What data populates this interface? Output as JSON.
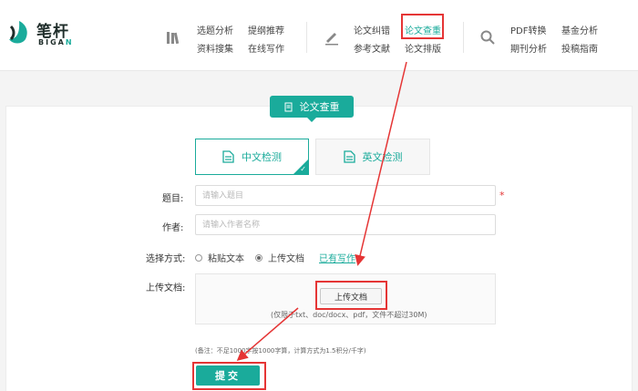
{
  "logo": {
    "cn": "笔杆",
    "en_main": "BIGA",
    "en_accent": "N"
  },
  "nav": {
    "group1": {
      "row1": [
        "选题分析",
        "提纲推荐"
      ],
      "row2": [
        "资料搜集",
        "在线写作"
      ]
    },
    "group2": {
      "row1": [
        "论文纠错",
        "论文查重"
      ],
      "row2": [
        "参考文献",
        "论文排版"
      ]
    },
    "group3": {
      "row1": [
        "PDF转换",
        "基金分析"
      ],
      "row2": [
        "期刊分析",
        "投稿指南"
      ]
    }
  },
  "section_tag": "论文查重",
  "modes": {
    "cn": "中文检测",
    "en": "英文检测"
  },
  "form": {
    "title_label": "题目:",
    "title_placeholder": "请输入题目",
    "author_label": "作者:",
    "author_placeholder": "请输入作者名称",
    "method_label": "选择方式:",
    "option_paste": "粘贴文本",
    "option_upload": "上传文档",
    "already_link": "已有写作",
    "upload_label": "上传文档:",
    "upload_button": "上传文档",
    "upload_note": "(仅限于txt、doc/docx、pdf，文件不超过30M)",
    "remark": "(备注：不足1000字按1000字算，计算方式为1.5积分/千字)",
    "submit": "提交",
    "required_mark": "*"
  },
  "colors": {
    "accent": "#1aab9b",
    "highlight": "#e53535"
  }
}
